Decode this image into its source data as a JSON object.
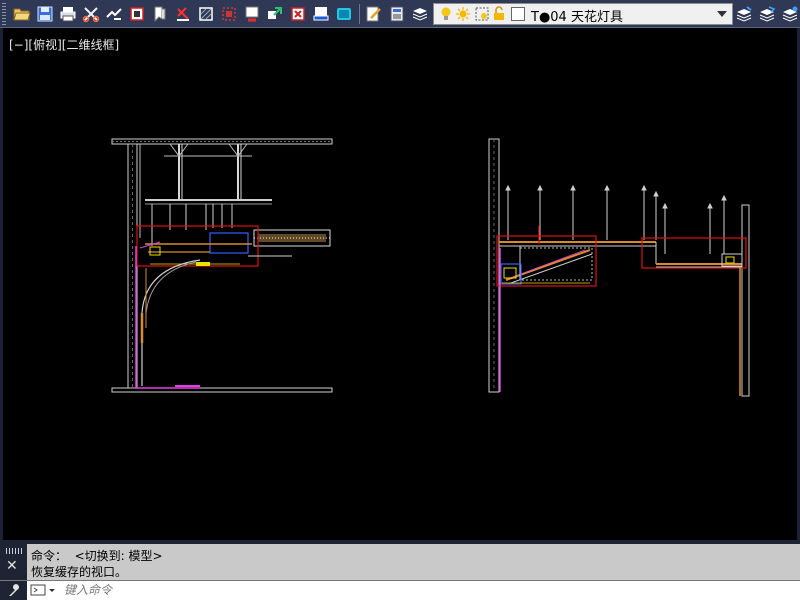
{
  "toolbar": {
    "tools": [
      {
        "name": "open-icon"
      },
      {
        "name": "save-icon"
      },
      {
        "name": "print-icon"
      },
      {
        "name": "cut-icon"
      },
      {
        "name": "copy-icon"
      },
      {
        "name": "paste-icon"
      },
      {
        "name": "match-properties-icon"
      },
      {
        "name": "undo-icon"
      },
      {
        "name": "block-icon"
      },
      {
        "name": "hatch-icon"
      },
      {
        "name": "insert-icon"
      },
      {
        "name": "xref-icon"
      },
      {
        "name": "purge-icon"
      },
      {
        "name": "plot-icon"
      },
      {
        "name": "layout-icon"
      },
      {
        "name": "edit-icon"
      },
      {
        "name": "calculator-icon"
      },
      {
        "name": "layer-properties-icon"
      }
    ],
    "right_tools": [
      {
        "name": "layer-states-icon"
      },
      {
        "name": "layer-previous-icon"
      },
      {
        "name": "layer-isolate-icon"
      }
    ]
  },
  "layer": {
    "current": "T●04 天花灯具",
    "color": "#ffffff"
  },
  "viewport": {
    "label": "[−][俯视][二维线框]"
  },
  "command": {
    "history": [
      "命令：  <切换到: 模型>",
      "恢复缓存的视口。"
    ],
    "placeholder": "键入命令"
  },
  "colors": {
    "toolbar_bg": "#2f3854",
    "canvas_bg": "#000000",
    "command_bg": "#c9c9c9",
    "red": "#e01010",
    "orange": "#d98b2b",
    "yellow": "#f0e000",
    "magenta": "#e040e0",
    "blue": "#3060ff"
  }
}
